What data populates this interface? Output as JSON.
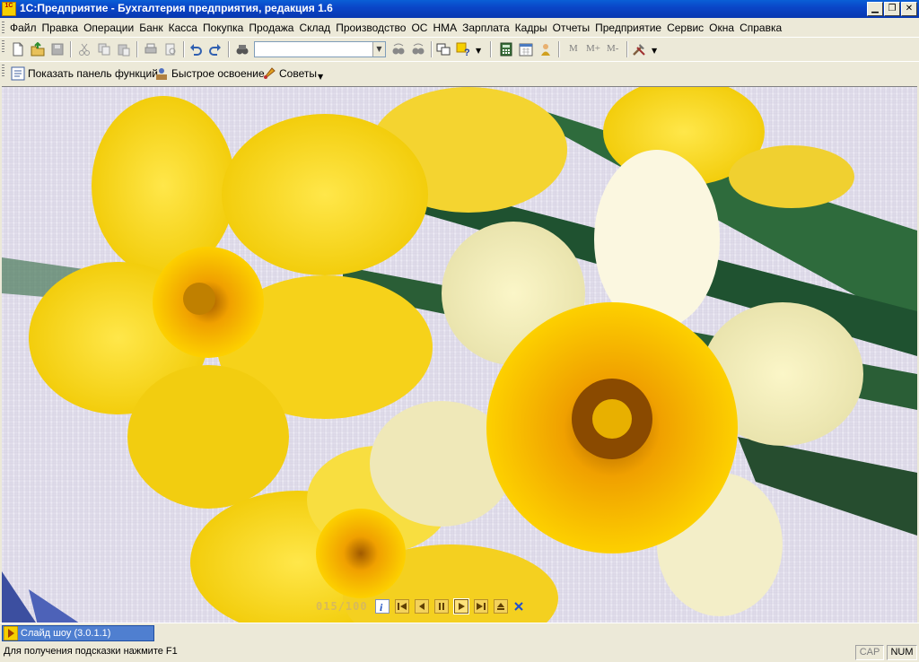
{
  "window": {
    "title": "1С:Предприятие - Бухгалтерия предприятия, редакция 1.6",
    "app_icon_text": "1С"
  },
  "menu": [
    "Файл",
    "Правка",
    "Операции",
    "Банк",
    "Касса",
    "Покупка",
    "Продажа",
    "Склад",
    "Производство",
    "ОС",
    "НМА",
    "Зарплата",
    "Кадры",
    "Отчеты",
    "Предприятие",
    "Сервис",
    "Окна",
    "Справка"
  ],
  "toolbar": {
    "search_value": "",
    "memory_buttons": [
      "M",
      "M+",
      "M-"
    ]
  },
  "panel_toolbar": {
    "show_functions": "Показать панель функций",
    "quick_learning": "Быстрое освоение",
    "tips": "Советы"
  },
  "slideshow": {
    "counter": "015/100",
    "controls": [
      "info-icon",
      "first-icon",
      "prev-icon",
      "pause-icon",
      "play-icon",
      "last-icon",
      "eject-icon",
      "close-icon"
    ]
  },
  "taskbar": {
    "task_label": "Слайд шоу (3.0.1.1)"
  },
  "status": {
    "hint": "Для получения подсказки нажмите F1",
    "cap": "CAP",
    "num": "NUM"
  },
  "colors": {
    "titlebar": "#0a46c8",
    "chrome": "#ece9d8",
    "taskbar_tab": "#4f7fd0"
  }
}
